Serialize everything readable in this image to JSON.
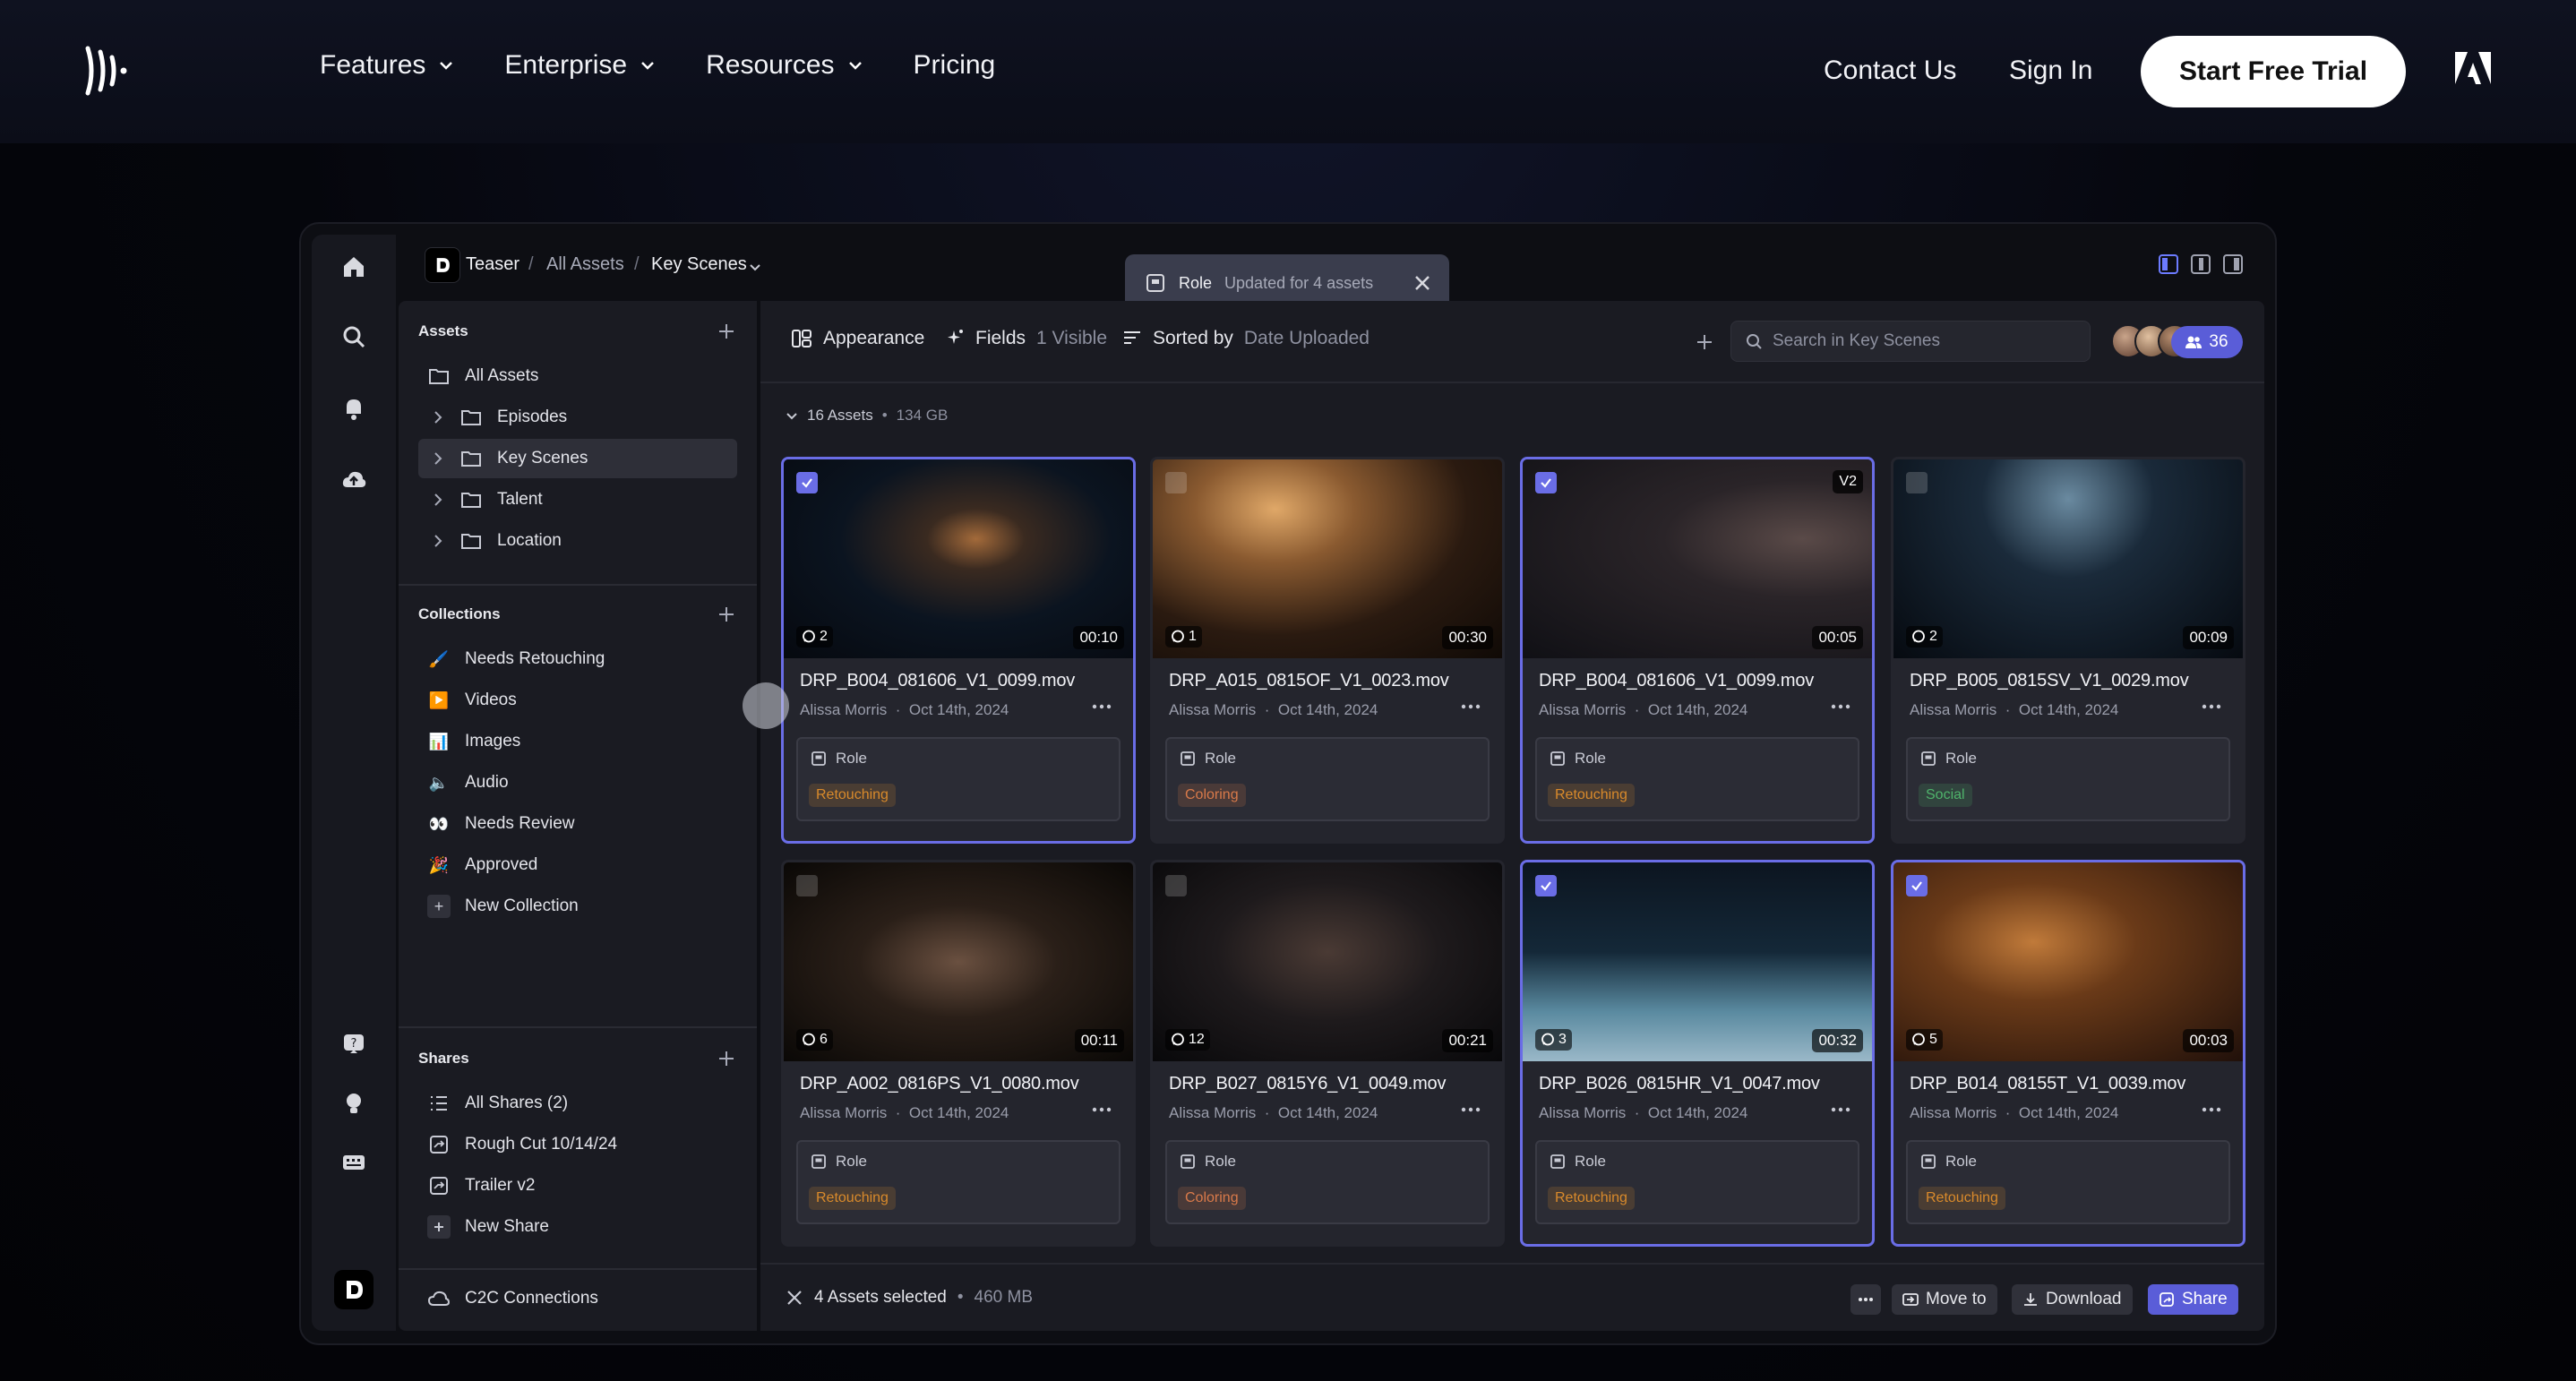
{
  "site_nav": {
    "links": [
      {
        "label": "Features",
        "has_menu": true
      },
      {
        "label": "Enterprise",
        "has_menu": true
      },
      {
        "label": "Resources",
        "has_menu": true
      },
      {
        "label": "Pricing",
        "has_menu": false
      }
    ],
    "contact": "Contact Us",
    "signin": "Sign In",
    "cta": "Start Free Trial"
  },
  "app": {
    "breadcrumb": {
      "workspace": "Teaser",
      "sep": "/",
      "parent": "All Assets",
      "current": "Key Scenes"
    },
    "toast": {
      "title": "Role",
      "message": "Updated for 4 assets"
    },
    "sidebar": {
      "assets_header": "Assets",
      "assets": [
        {
          "label": "All Assets"
        },
        {
          "label": "Episodes"
        },
        {
          "label": "Key Scenes"
        },
        {
          "label": "Talent"
        },
        {
          "label": "Location"
        }
      ],
      "collections_header": "Collections",
      "collections": [
        {
          "label": "Needs Retouching",
          "emoji": "🖌️"
        },
        {
          "label": "Videos",
          "emoji": "▶️"
        },
        {
          "label": "Images",
          "emoji": "📊"
        },
        {
          "label": "Audio",
          "emoji": "🔈"
        },
        {
          "label": "Needs Review",
          "emoji": "👀"
        },
        {
          "label": "Approved",
          "emoji": "🎉"
        },
        {
          "label": "New Collection",
          "emoji": "+"
        }
      ],
      "shares_header": "Shares",
      "shares": [
        {
          "label": "All Shares (2)"
        },
        {
          "label": "Rough Cut 10/14/24"
        },
        {
          "label": "Trailer v2"
        },
        {
          "label": "New Share"
        }
      ],
      "c2c": "C2C Connections"
    },
    "toolbar": {
      "appearance": "Appearance",
      "fields": "Fields",
      "fields_count": "1 Visible",
      "sorted_by": "Sorted by",
      "sort_value": "Date Uploaded",
      "search_placeholder": "Search in Key Scenes",
      "member_count": "36"
    },
    "summary": {
      "count": "16 Assets",
      "size": "134 GB"
    },
    "role_label": "Role",
    "cards": [
      {
        "filename": "DRP_B004_081606_V1_0099.mov",
        "author": "Alissa Morris",
        "date": "Oct 14th, 2024",
        "comments": "2",
        "duration": "00:10",
        "role": "Retouching",
        "role_color": "#d98a2b",
        "selected": true,
        "version": ""
      },
      {
        "filename": "DRP_A015_0815OF_V1_0023.mov",
        "author": "Alissa Morris",
        "date": "Oct 14th, 2024",
        "comments": "1",
        "duration": "00:30",
        "role": "Coloring",
        "role_color": "#d97a4a",
        "selected": false,
        "version": ""
      },
      {
        "filename": "DRP_B004_081606_V1_0099.mov",
        "author": "Alissa Morris",
        "date": "Oct 14th, 2024",
        "comments": "",
        "duration": "00:05",
        "role": "Retouching",
        "role_color": "#d98a2b",
        "selected": true,
        "version": "V2"
      },
      {
        "filename": "DRP_B005_0815SV_V1_0029.mov",
        "author": "Alissa Morris",
        "date": "Oct 14th, 2024",
        "comments": "2",
        "duration": "00:09",
        "role": "Social",
        "role_color": "#4fb36b",
        "selected": false,
        "version": ""
      },
      {
        "filename": "DRP_A002_0816PS_V1_0080.mov",
        "author": "Alissa Morris",
        "date": "Oct 14th, 2024",
        "comments": "6",
        "duration": "00:11",
        "role": "Retouching",
        "role_color": "#d98a2b",
        "selected": false,
        "version": ""
      },
      {
        "filename": "DRP_B027_0815Y6_V1_0049.mov",
        "author": "Alissa Morris",
        "date": "Oct 14th, 2024",
        "comments": "12",
        "duration": "00:21",
        "role": "Coloring",
        "role_color": "#d97a4a",
        "selected": false,
        "version": ""
      },
      {
        "filename": "DRP_B026_0815HR_V1_0047.mov",
        "author": "Alissa Morris",
        "date": "Oct 14th, 2024",
        "comments": "3",
        "duration": "00:32",
        "role": "Retouching",
        "role_color": "#d98a2b",
        "selected": true,
        "version": ""
      },
      {
        "filename": "DRP_B014_08155T_V1_0039.mov",
        "author": "Alissa Morris",
        "date": "Oct 14th, 2024",
        "comments": "5",
        "duration": "00:03",
        "role": "Retouching",
        "role_color": "#d98a2b",
        "selected": true,
        "version": ""
      }
    ],
    "bottom_bar": {
      "selected": "4 Assets selected",
      "size": "460 MB",
      "move": "Move to",
      "download": "Download",
      "share": "Share"
    }
  },
  "colors": {
    "accent": "#5a5dd8",
    "selection": "#6a6de6"
  }
}
